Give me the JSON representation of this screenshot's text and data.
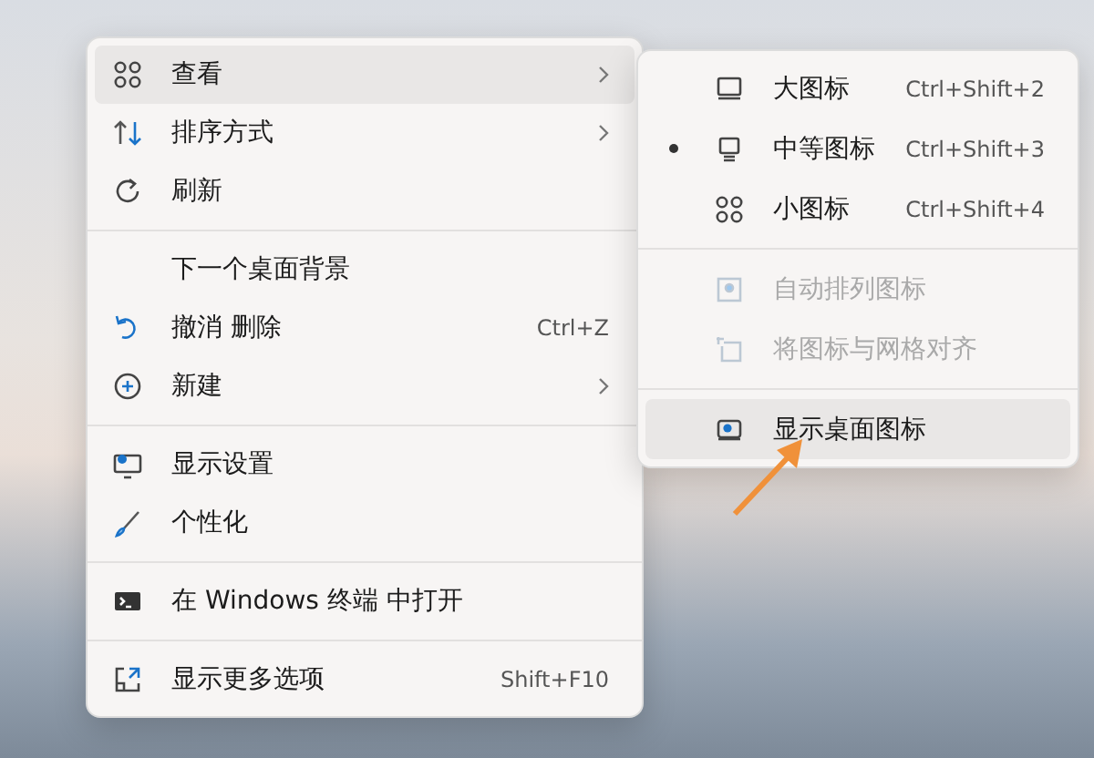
{
  "context_menu": {
    "groups": [
      [
        {
          "label": "查看",
          "submenu": true,
          "highlighted": true
        },
        {
          "label": "排序方式",
          "submenu": true,
          "highlighted": false
        },
        {
          "label": "刷新",
          "submenu": false,
          "highlighted": false
        }
      ],
      [
        {
          "label": "下一个桌面背景",
          "submenu": false,
          "highlighted": false
        },
        {
          "label": "撤消 删除",
          "shortcut": "Ctrl+Z",
          "submenu": false,
          "highlighted": false
        },
        {
          "label": "新建",
          "submenu": true,
          "highlighted": false
        }
      ],
      [
        {
          "label": "显示设置",
          "submenu": false,
          "highlighted": false
        },
        {
          "label": "个性化",
          "submenu": false,
          "highlighted": false
        }
      ],
      [
        {
          "label": "在 Windows 终端 中打开",
          "submenu": false,
          "highlighted": false
        }
      ],
      [
        {
          "label": "显示更多选项",
          "shortcut": "Shift+F10",
          "submenu": false,
          "highlighted": false
        }
      ]
    ]
  },
  "view_submenu": {
    "groups": [
      [
        {
          "label": "大图标",
          "shortcut": "Ctrl+Shift+2",
          "selected": false,
          "disabled": false,
          "highlighted": false
        },
        {
          "label": "中等图标",
          "shortcut": "Ctrl+Shift+3",
          "selected": true,
          "disabled": false,
          "highlighted": false
        },
        {
          "label": "小图标",
          "shortcut": "Ctrl+Shift+4",
          "selected": false,
          "disabled": false,
          "highlighted": false
        }
      ],
      [
        {
          "label": "自动排列图标",
          "selected": false,
          "disabled": true,
          "highlighted": false
        },
        {
          "label": "将图标与网格对齐",
          "selected": false,
          "disabled": true,
          "highlighted": false
        }
      ],
      [
        {
          "label": "显示桌面图标",
          "selected": false,
          "disabled": false,
          "highlighted": true
        }
      ]
    ]
  }
}
